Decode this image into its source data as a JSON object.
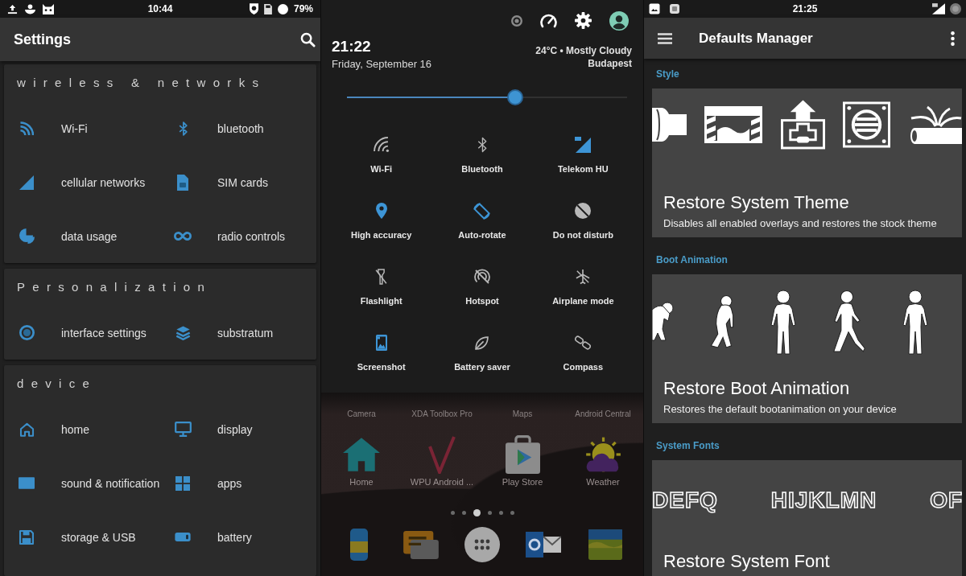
{
  "settings_screen": {
    "status_bar": {
      "time": "10:44",
      "battery": "79%"
    },
    "app_bar": {
      "title": "Settings"
    },
    "sections": [
      {
        "title": "wireless & networks",
        "items": [
          {
            "label": "Wi-Fi"
          },
          {
            "label": "bluetooth"
          },
          {
            "label": "cellular networks"
          },
          {
            "label": "SIM cards"
          },
          {
            "label": "data usage"
          },
          {
            "label": "radio controls"
          }
        ]
      },
      {
        "title": "Personalization",
        "items": [
          {
            "label": "interface settings"
          },
          {
            "label": "substratum"
          }
        ]
      },
      {
        "title": "device",
        "items": [
          {
            "label": "home"
          },
          {
            "label": "display"
          },
          {
            "label": "sound & notification"
          },
          {
            "label": "apps"
          },
          {
            "label": "storage & USB"
          },
          {
            "label": "battery"
          }
        ]
      }
    ]
  },
  "quick_settings_screen": {
    "header": {
      "time": "21:22",
      "date": "Friday, September 16",
      "weather": "24°C • Mostly Cloudy",
      "location": "Budapest"
    },
    "brightness": {
      "level": 0.6
    },
    "tiles": [
      {
        "label": "Wi-Fi",
        "on": false
      },
      {
        "label": "Bluetooth",
        "on": false
      },
      {
        "label": "Telekom HU",
        "on": true
      },
      {
        "label": "High accuracy",
        "on": true
      },
      {
        "label": "Auto-rotate",
        "on": true
      },
      {
        "label": "Do not disturb",
        "on": false
      },
      {
        "label": "Flashlight",
        "on": false
      },
      {
        "label": "Hotspot",
        "on": false
      },
      {
        "label": "Airplane mode",
        "on": false
      },
      {
        "label": "Screenshot",
        "on": true
      },
      {
        "label": "Battery saver",
        "on": false
      },
      {
        "label": "Compass",
        "on": false
      }
    ],
    "home_screen": {
      "row_labels": [
        "Camera",
        "XDA Toolbox Pro",
        "Maps",
        "Android Central"
      ],
      "apps": [
        {
          "label": "Home"
        },
        {
          "label": "WPU Android ..."
        },
        {
          "label": "Play Store"
        },
        {
          "label": "Weather"
        }
      ],
      "pages": [
        {
          "selected": false
        },
        {
          "selected": false
        },
        {
          "selected": true
        },
        {
          "selected": false
        },
        {
          "selected": false
        },
        {
          "selected": false
        }
      ]
    }
  },
  "defaults_manager_screen": {
    "status_bar": {
      "time": "21:25"
    },
    "app_bar": {
      "title": "Defaults Manager"
    },
    "sections": [
      {
        "heading": "Style",
        "card": {
          "kind": "icons",
          "title": "Restore System Theme",
          "description": "Disables all enabled overlays and restores the stock theme"
        }
      },
      {
        "heading": "Boot Animation",
        "card": {
          "kind": "figures",
          "title": "Restore Boot Animation",
          "description": "Restores the default bootanimation on your device"
        }
      },
      {
        "heading": "System Fonts",
        "card": {
          "kind": "fonts",
          "samples": [
            "DEFQ",
            "HIJKLMN",
            "OF"
          ],
          "title": "Restore System Font"
        }
      }
    ]
  }
}
